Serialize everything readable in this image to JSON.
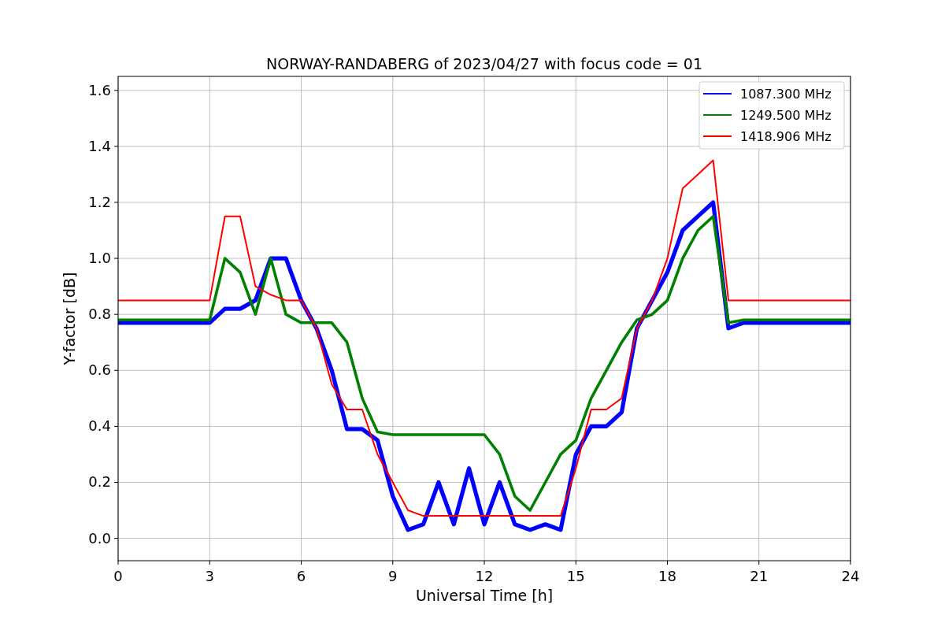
{
  "chart_data": {
    "type": "line",
    "title": "NORWAY-RANDABERG of 2023/04/27 with focus code = 01",
    "xlabel": "Universal Time [h]",
    "ylabel": "Y-factor [dB]",
    "x": [
      0,
      0.5,
      1,
      1.5,
      2,
      2.5,
      3,
      3.5,
      4,
      4.5,
      5,
      5.5,
      6,
      6.5,
      7,
      7.5,
      8,
      8.5,
      9,
      9.5,
      10,
      10.5,
      11,
      11.5,
      12,
      12.5,
      13,
      13.5,
      14,
      14.5,
      15,
      15.5,
      16,
      16.5,
      17,
      17.5,
      18,
      18.5,
      19,
      19.5,
      20,
      20.5,
      21,
      21.5,
      22,
      22.5,
      23,
      23.5,
      24
    ],
    "series": [
      {
        "name": "1087.300 MHz",
        "color": "#0000ff",
        "values": [
          0.77,
          0.77,
          0.77,
          0.77,
          0.77,
          0.77,
          0.77,
          0.82,
          0.82,
          0.85,
          1.0,
          1.0,
          0.85,
          0.75,
          0.6,
          0.39,
          0.39,
          0.35,
          0.15,
          0.03,
          0.05,
          0.2,
          0.05,
          0.25,
          0.05,
          0.2,
          0.05,
          0.03,
          0.05,
          0.03,
          0.3,
          0.4,
          0.4,
          0.45,
          0.75,
          0.85,
          0.95,
          1.1,
          1.15,
          1.2,
          0.75,
          0.77,
          0.77,
          0.77,
          0.77,
          0.77,
          0.77,
          0.77,
          0.77
        ]
      },
      {
        "name": "1249.500 MHz",
        "color": "#008000",
        "values": [
          0.78,
          0.78,
          0.78,
          0.78,
          0.78,
          0.78,
          0.78,
          1.0,
          0.95,
          0.8,
          1.0,
          0.8,
          0.77,
          0.77,
          0.77,
          0.7,
          0.5,
          0.38,
          0.37,
          0.37,
          0.37,
          0.37,
          0.37,
          0.37,
          0.37,
          0.3,
          0.15,
          0.1,
          0.2,
          0.3,
          0.35,
          0.5,
          0.6,
          0.7,
          0.78,
          0.8,
          0.85,
          1.0,
          1.1,
          1.15,
          0.77,
          0.78,
          0.78,
          0.78,
          0.78,
          0.78,
          0.78,
          0.78,
          0.78
        ]
      },
      {
        "name": "1418.906 MHz",
        "color": "#ff0000",
        "values": [
          0.85,
          0.85,
          0.85,
          0.85,
          0.85,
          0.85,
          0.85,
          1.15,
          1.15,
          0.9,
          0.87,
          0.85,
          0.85,
          0.75,
          0.55,
          0.46,
          0.46,
          0.3,
          0.2,
          0.1,
          0.08,
          0.08,
          0.08,
          0.08,
          0.08,
          0.08,
          0.08,
          0.08,
          0.08,
          0.08,
          0.25,
          0.46,
          0.46,
          0.5,
          0.75,
          0.85,
          1.0,
          1.25,
          1.3,
          1.35,
          0.85,
          0.85,
          0.85,
          0.85,
          0.85,
          0.85,
          0.85,
          0.85,
          0.85
        ]
      }
    ],
    "grid": true,
    "legend": true,
    "xlim": [
      0,
      24
    ],
    "ylim": [
      -0.08,
      1.65
    ],
    "xticks": [
      0,
      3,
      6,
      9,
      12,
      15,
      18,
      21,
      24
    ],
    "yticks": [
      {
        "value": 0,
        "label": "0.0"
      },
      {
        "value": 0.2,
        "label": "0.2"
      },
      {
        "value": 0.4,
        "label": "0.4"
      },
      {
        "value": 0.6,
        "label": "0.6"
      },
      {
        "value": 0.8,
        "label": "0.8"
      },
      {
        "value": 1.0,
        "label": "1.0"
      },
      {
        "value": 1.2,
        "label": "1.2"
      },
      {
        "value": 1.4,
        "label": "1.4"
      },
      {
        "value": 1.6,
        "label": "1.6"
      }
    ]
  }
}
